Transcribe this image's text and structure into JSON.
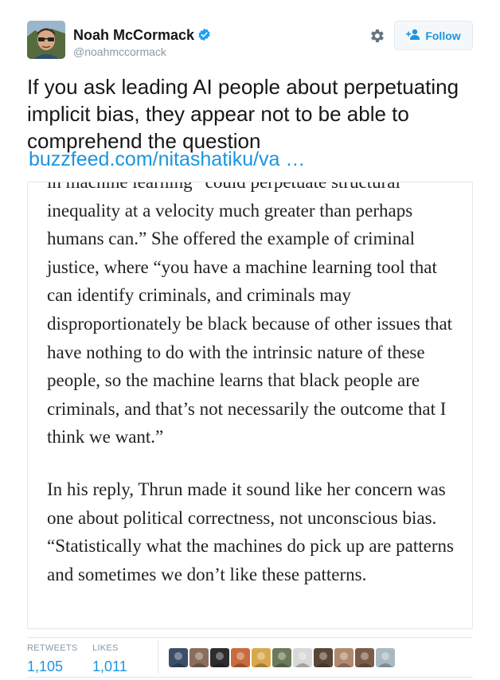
{
  "user": {
    "name": "Noah McCormack",
    "handle": "@noahmccormack",
    "verified": true,
    "accent": "#1da1f2"
  },
  "actions": {
    "settings_icon": "gear-icon",
    "follow_label": "Follow",
    "follow_icon": "add-person-icon"
  },
  "tweet": {
    "text": "If you ask leading AI people about perpetuating implicit bias, they appear not to be able to comprehend the question",
    "link": "buzzfeed.com/nitashatiku/va …",
    "link_color": "#1b95e0"
  },
  "article": {
    "paragraphs": [
      "in machine learning “could perpetuate structural inequality at a velocity much greater than perhaps humans can.” She offered the example of criminal justice, where “you have a machine learning tool that can identify criminals, and criminals may disproportionately be black because of other issues that have nothing to do with the intrinsic nature of these people, so the machine learns that black people are criminals, and that’s not necessarily the outcome that I think we want.”",
      "In his reply, Thrun made it sound like her concern was one about political correctness, not unconscious bias. “Statistically what the machines do pick up are patterns and sometimes we don’t like these patterns."
    ]
  },
  "stats": {
    "retweets_label": "RETWEETS",
    "retweets_value": "1,105",
    "likes_label": "LIKES",
    "likes_value": "1,011"
  },
  "likers": [
    {
      "color": "#3b4f6b"
    },
    {
      "color": "#8a6d5c"
    },
    {
      "color": "#2d2d2d"
    },
    {
      "color": "#c96b3c"
    },
    {
      "color": "#d9a84e"
    },
    {
      "color": "#6b7a5a"
    },
    {
      "color": "#d8d8d8"
    },
    {
      "color": "#5a4634"
    },
    {
      "color": "#b08a6e"
    },
    {
      "color": "#7a5c48"
    },
    {
      "color": "#aab8c2"
    }
  ]
}
